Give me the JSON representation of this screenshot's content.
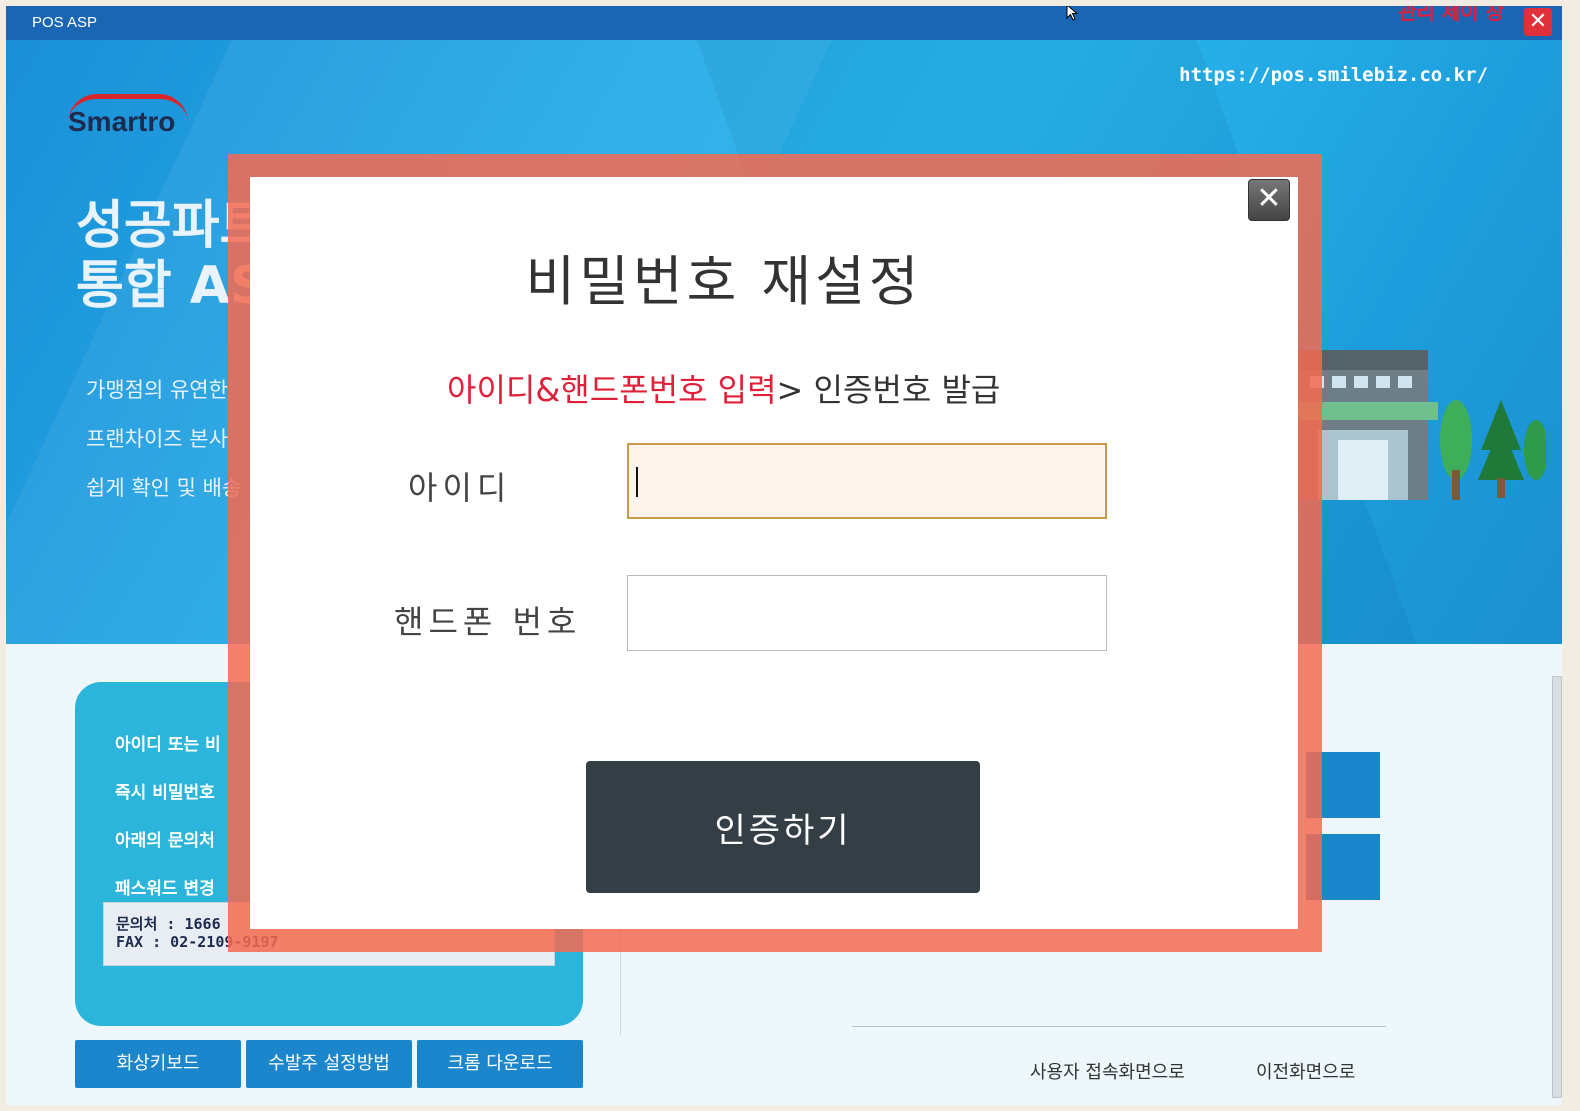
{
  "window": {
    "title": "POS ASP",
    "status_text": "관리 제이 창",
    "close_label": "✕"
  },
  "banner": {
    "url": "https://pos.smilebiz.co.kr/",
    "logo_text": "Smartro",
    "headline_line1": "성공파트",
    "headline_line2": "통합 AS",
    "subtext": [
      "가맹점의 유연한",
      "프랜차이즈 본사",
      "쉽게 확인 및 배송"
    ]
  },
  "info_panel": {
    "lines": [
      "아이디 또는 비",
      "즉시 비밀번호",
      "아래의 문의처",
      "패스워드 변경"
    ],
    "contact_phone": "문의처 : 1666",
    "contact_fax": "FAX : 02-2109-9197"
  },
  "bottom_buttons": [
    "화상키보드",
    "수발주 설정방법",
    "크롬 다운로드"
  ],
  "bottom_links": [
    "사용자 접속화면으로",
    "이전화면으로"
  ],
  "dialog": {
    "title": "비밀번호 재설정",
    "step_active": "아이디&핸드폰번호 입력",
    "step_separator": ">",
    "step_next": " 인증번호 발급",
    "id_label": "아이디",
    "phone_label": "핸드폰 번호",
    "id_value": "",
    "phone_value": "",
    "submit_label": "인증하기",
    "close_label": "✕"
  },
  "colors": {
    "titlebar": "#1a66b3",
    "modal_border": "#f46a50",
    "accent_red": "#e0203a",
    "submit_bg": "#333f44",
    "info_panel": "#2bb5da",
    "button_blue": "#1b86cc"
  }
}
